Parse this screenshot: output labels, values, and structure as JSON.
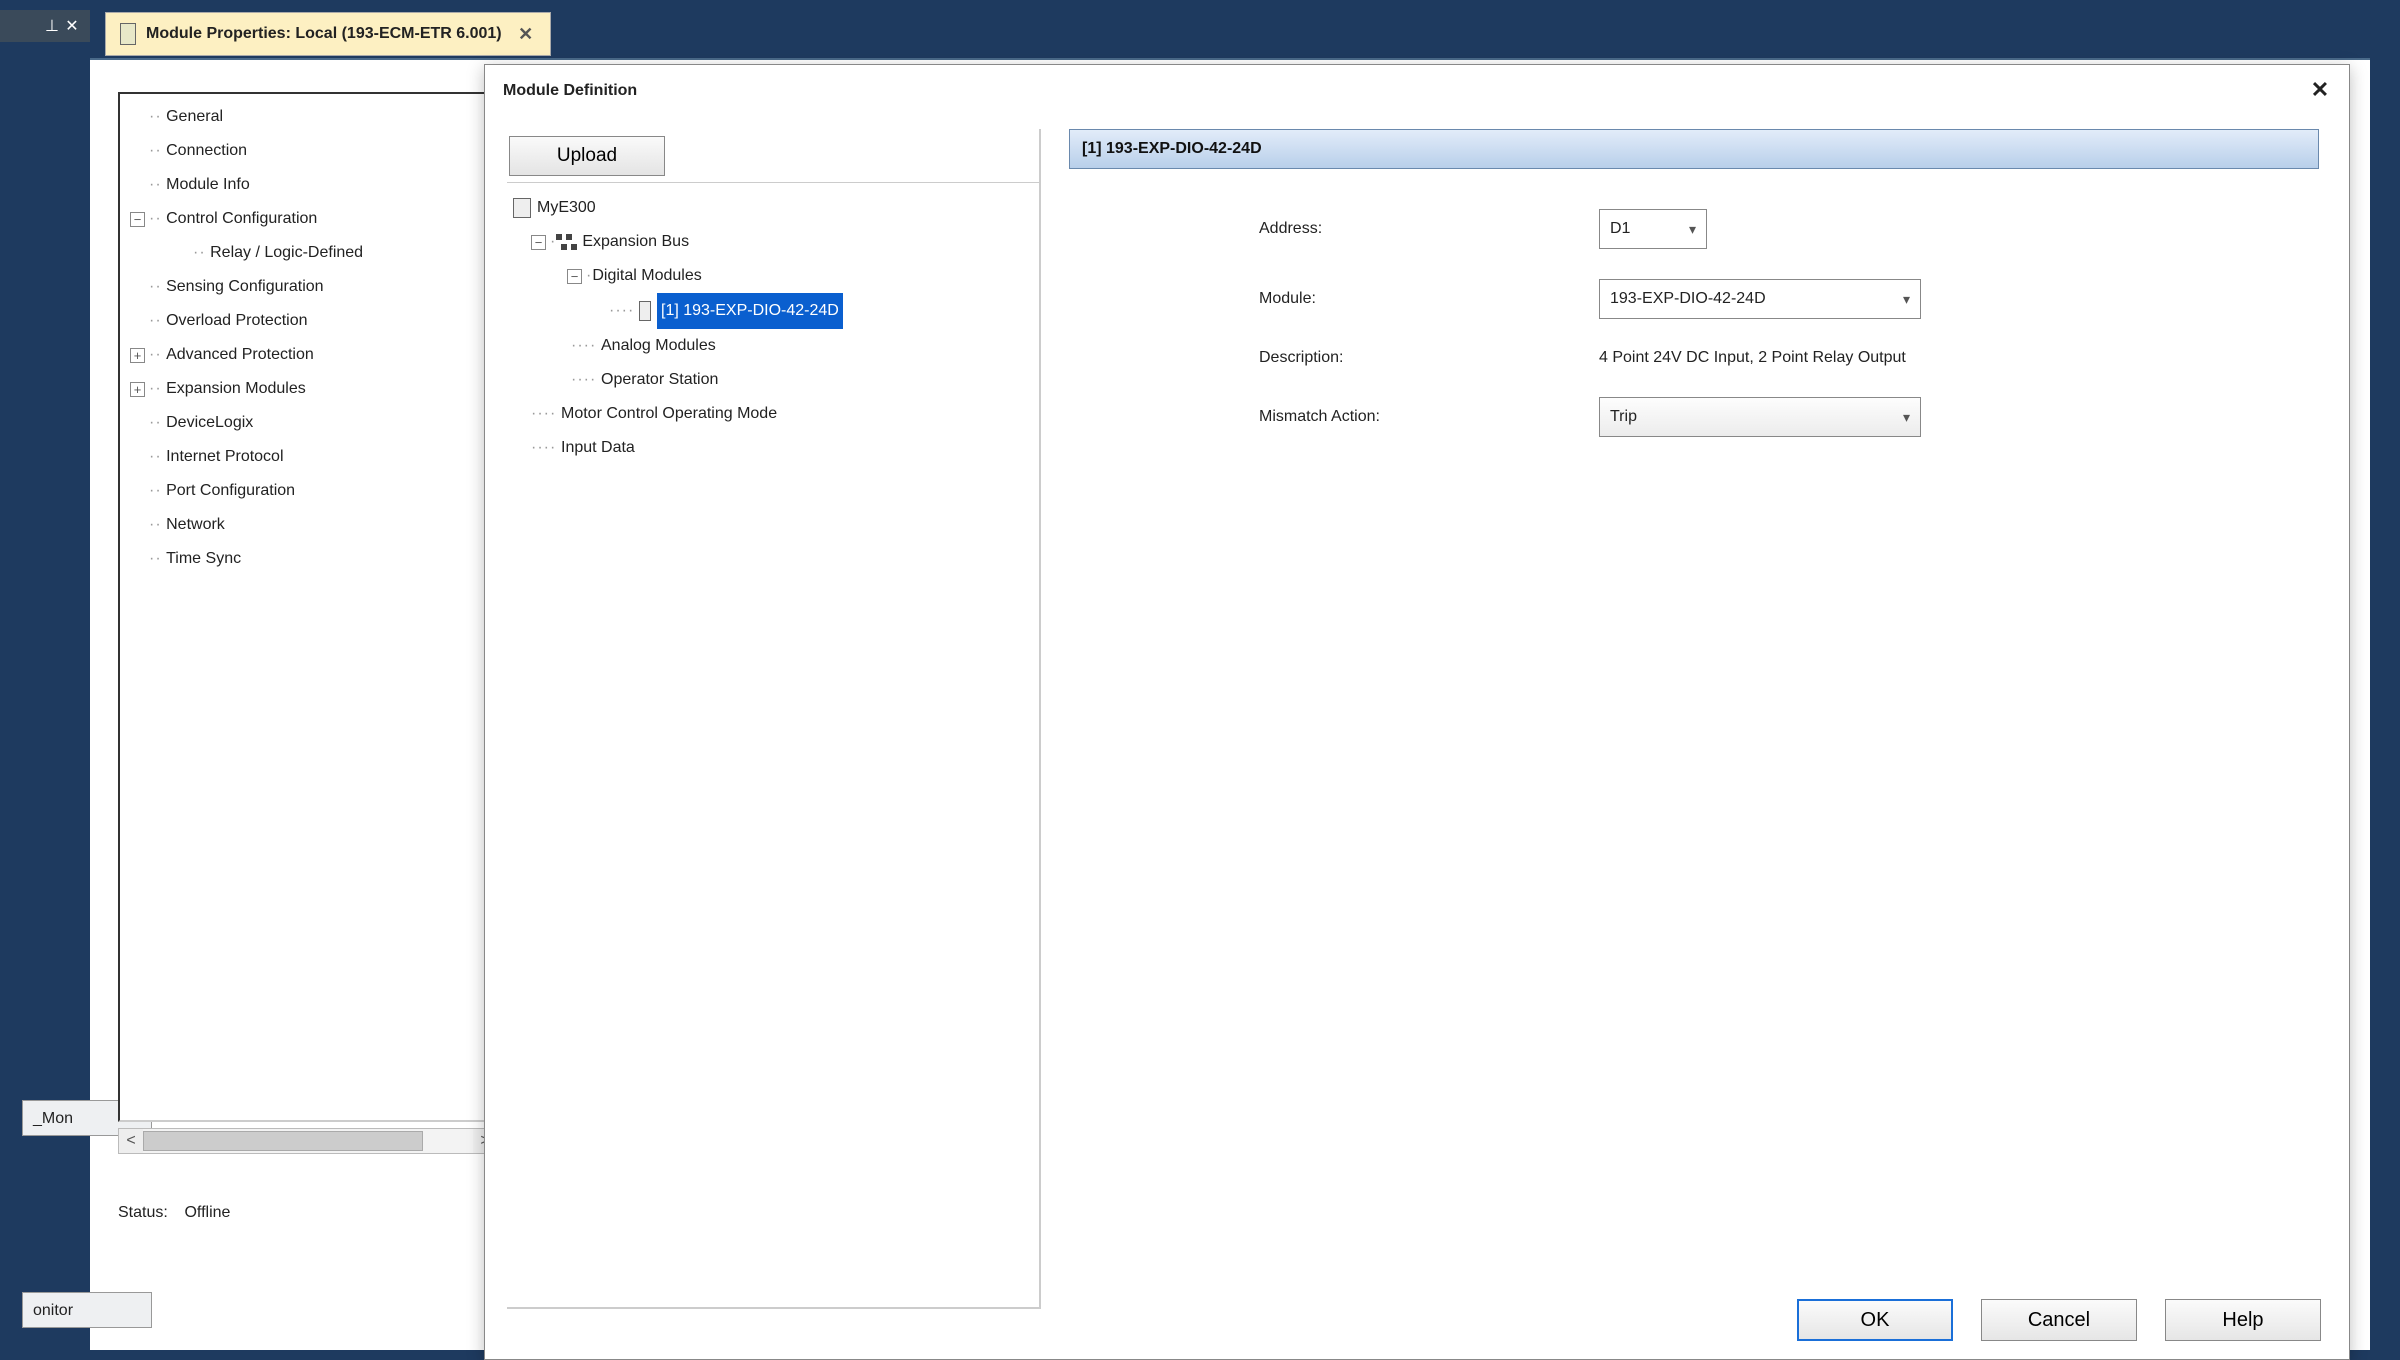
{
  "tab": {
    "title": "Module Properties: Local (193-ECM-ETR 6.001)"
  },
  "nav": {
    "items": [
      {
        "label": "General",
        "depth": 0,
        "toggle": null
      },
      {
        "label": "Connection",
        "depth": 0,
        "toggle": null
      },
      {
        "label": "Module Info",
        "depth": 0,
        "toggle": null
      },
      {
        "label": "Control Configuration",
        "depth": 0,
        "toggle": "-"
      },
      {
        "label": "Relay / Logic-Defined",
        "depth": 1,
        "toggle": null
      },
      {
        "label": "Sensing Configuration",
        "depth": 0,
        "toggle": null
      },
      {
        "label": "Overload Protection",
        "depth": 0,
        "toggle": null
      },
      {
        "label": "Advanced Protection",
        "depth": 0,
        "toggle": "+"
      },
      {
        "label": "Expansion Modules",
        "depth": 0,
        "toggle": "+"
      },
      {
        "label": "DeviceLogix",
        "depth": 0,
        "toggle": null
      },
      {
        "label": "Internet Protocol",
        "depth": 0,
        "toggle": null
      },
      {
        "label": "Port Configuration",
        "depth": 0,
        "toggle": null
      },
      {
        "label": "Network",
        "depth": 0,
        "toggle": null
      },
      {
        "label": "Time Sync",
        "depth": 0,
        "toggle": null
      }
    ]
  },
  "status": {
    "label": "Status:",
    "value": "Offline"
  },
  "sideTabs": {
    "a": "_Mon",
    "b": "onitor"
  },
  "dialog": {
    "title": "Module Definition",
    "upload": "Upload",
    "tree": {
      "root": "MyE300",
      "bus": "Expansion Bus",
      "digital": "Digital Modules",
      "selected": "[1] 193-EXP-DIO-42-24D",
      "analog": "Analog Modules",
      "operator": "Operator Station",
      "motor": "Motor Control Operating Mode",
      "input": "Input Data"
    },
    "detail": {
      "header": "[1] 193-EXP-DIO-42-24D",
      "addressLabel": "Address:",
      "addressValue": "D1",
      "moduleLabel": "Module:",
      "moduleValue": "193-EXP-DIO-42-24D",
      "descLabel": "Description:",
      "descValue": "4 Point 24V DC Input, 2 Point Relay Output",
      "mismatchLabel": "Mismatch Action:",
      "mismatchValue": "Trip"
    },
    "buttons": {
      "ok": "OK",
      "cancel": "Cancel",
      "help": "Help"
    }
  }
}
